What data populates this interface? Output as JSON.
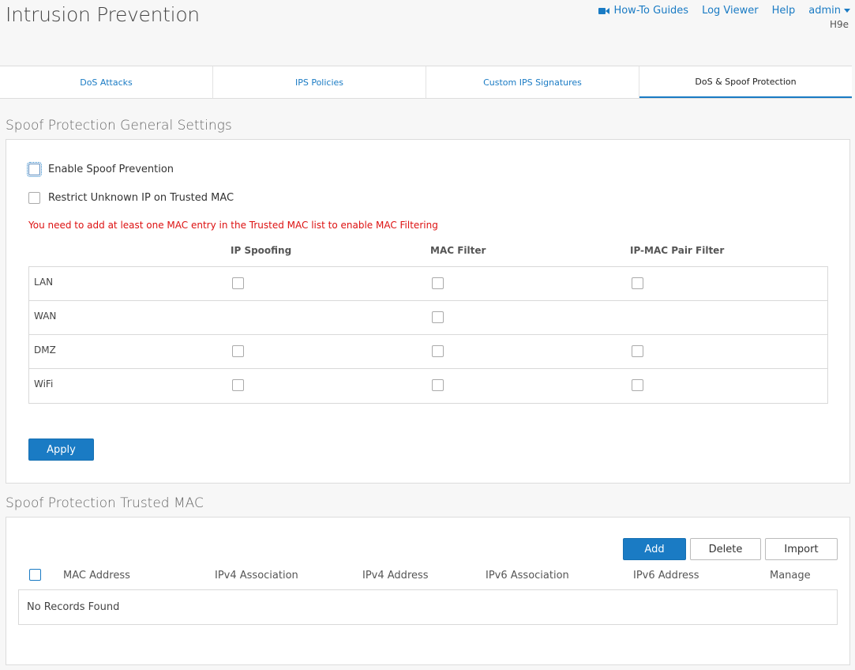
{
  "header": {
    "title": "Intrusion Prevention",
    "links": {
      "howto": "How-To Guides",
      "log_viewer": "Log Viewer",
      "help": "Help",
      "user": "admin"
    },
    "device": "H9e"
  },
  "tabs": [
    {
      "label": "DoS Attacks"
    },
    {
      "label": "IPS Policies"
    },
    {
      "label": "Custom IPS Signatures"
    },
    {
      "label": "DoS & Spoof Protection"
    }
  ],
  "general": {
    "title": "Spoof Protection General Settings",
    "enable_label": "Enable Spoof Prevention",
    "restrict_label": "Restrict Unknown IP on Trusted MAC",
    "warning": "You need to add at least one MAC entry in the Trusted MAC list to enable MAC Filtering",
    "columns": [
      "IP Spoofing",
      "MAC Filter",
      "IP-MAC Pair Filter"
    ],
    "rows": [
      {
        "label": "LAN"
      },
      {
        "label": "WAN"
      },
      {
        "label": "DMZ"
      },
      {
        "label": "WiFi"
      }
    ],
    "apply_label": "Apply"
  },
  "trusted": {
    "title": "Spoof Protection Trusted MAC",
    "add_label": "Add",
    "delete_label": "Delete",
    "import_label": "Import",
    "columns": [
      "MAC Address",
      "IPv4 Association",
      "IPv4 Address",
      "IPv6 Association",
      "IPv6 Address",
      "Manage"
    ],
    "empty": "No Records Found"
  },
  "colors": {
    "accent": "#1a7bc4",
    "warning": "#dd1111"
  }
}
